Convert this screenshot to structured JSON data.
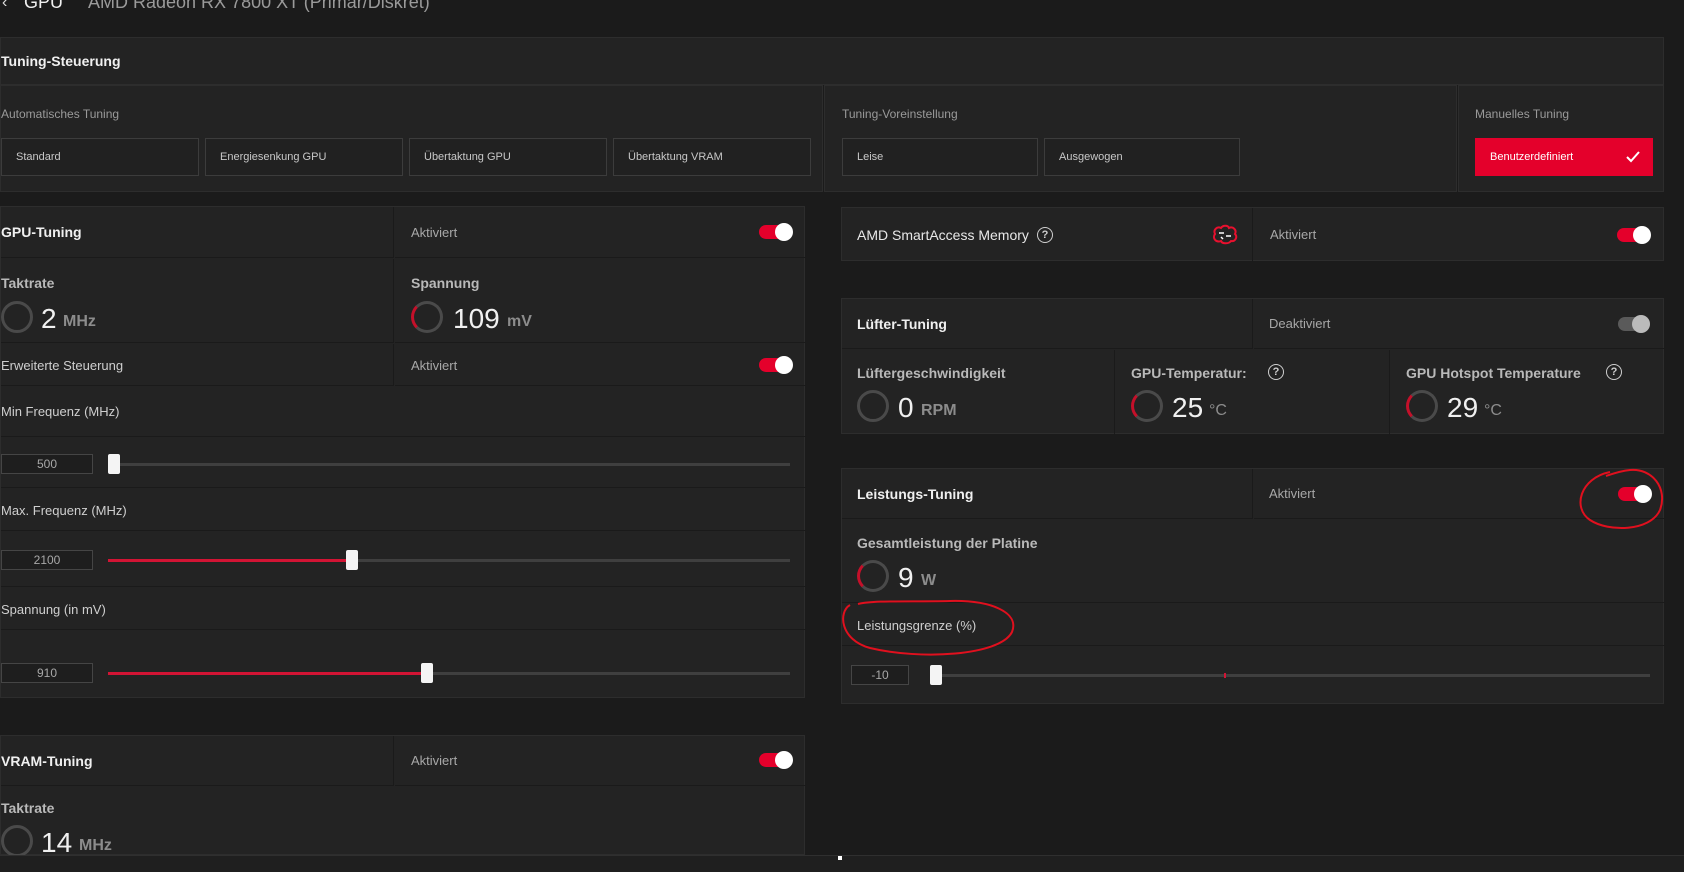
{
  "header": {
    "back_icon": "chevron-left-icon",
    "section": "GPU",
    "device": "AMD Radeon RX 7800 XT (Primär/Diskret)"
  },
  "tuning_control": {
    "title": "Tuning-Steuerung",
    "auto": {
      "label": "Automatisches Tuning",
      "buttons": [
        "Standard",
        "Energiesenkung GPU",
        "Übertaktung GPU",
        "Übertaktung VRAM"
      ]
    },
    "preset": {
      "label": "Tuning-Voreinstellung",
      "buttons": [
        "Leise",
        "Ausgewogen"
      ]
    },
    "manual": {
      "label": "Manuelles Tuning",
      "button": "Benutzerdefiniert"
    }
  },
  "gpu_tuning": {
    "title": "GPU-Tuning",
    "status": "Aktiviert",
    "enabled": true,
    "clock": {
      "label": "Taktrate",
      "value": "2",
      "unit": "MHz"
    },
    "voltage": {
      "label": "Spannung",
      "value": "109",
      "unit": "mV"
    },
    "advanced": {
      "label": "Erweiterte Steuerung",
      "status": "Aktiviert",
      "enabled": true
    },
    "min_freq": {
      "label": "Min Frequenz (MHz)",
      "value": "500",
      "fraction": 0.0
    },
    "max_freq": {
      "label": "Max. Frequenz (MHz)",
      "value": "2100",
      "fraction": 0.358
    },
    "voltage_mv": {
      "label": "Spannung (in mV)",
      "value": "910",
      "fraction": 0.469
    }
  },
  "vram_tuning": {
    "title": "VRAM-Tuning",
    "status": "Aktiviert",
    "enabled": true,
    "clock": {
      "label": "Taktrate",
      "value": "14",
      "unit": "MHz"
    }
  },
  "smart_access": {
    "title": "AMD SmartAccess Memory",
    "help_icon": "question-circle-icon",
    "brain_icon": "brain-icon",
    "status": "Aktiviert",
    "enabled": true
  },
  "fan_tuning": {
    "title": "Lüfter-Tuning",
    "status": "Deaktiviert",
    "enabled": false,
    "fan_speed": {
      "label": "Lüftergeschwindigkeit",
      "value": "0",
      "unit": "RPM"
    },
    "gpu_temp": {
      "label": "GPU-Temperatur:",
      "value": "25",
      "unit": "°C"
    },
    "hotspot_temp": {
      "label": "GPU Hotspot Temperature",
      "value": "29",
      "unit": "°C"
    }
  },
  "power_tuning": {
    "title": "Leistungs-Tuning",
    "status": "Aktiviert",
    "enabled": true,
    "board_power": {
      "label": "Gesamtleistung der Platine",
      "value": "9",
      "unit": "W"
    },
    "power_limit": {
      "label": "Leistungsgrenze (%)",
      "value": "-10",
      "fraction": 0.0
    }
  },
  "colors": {
    "accent": "#e4002b",
    "annotation": "#e0101e"
  }
}
